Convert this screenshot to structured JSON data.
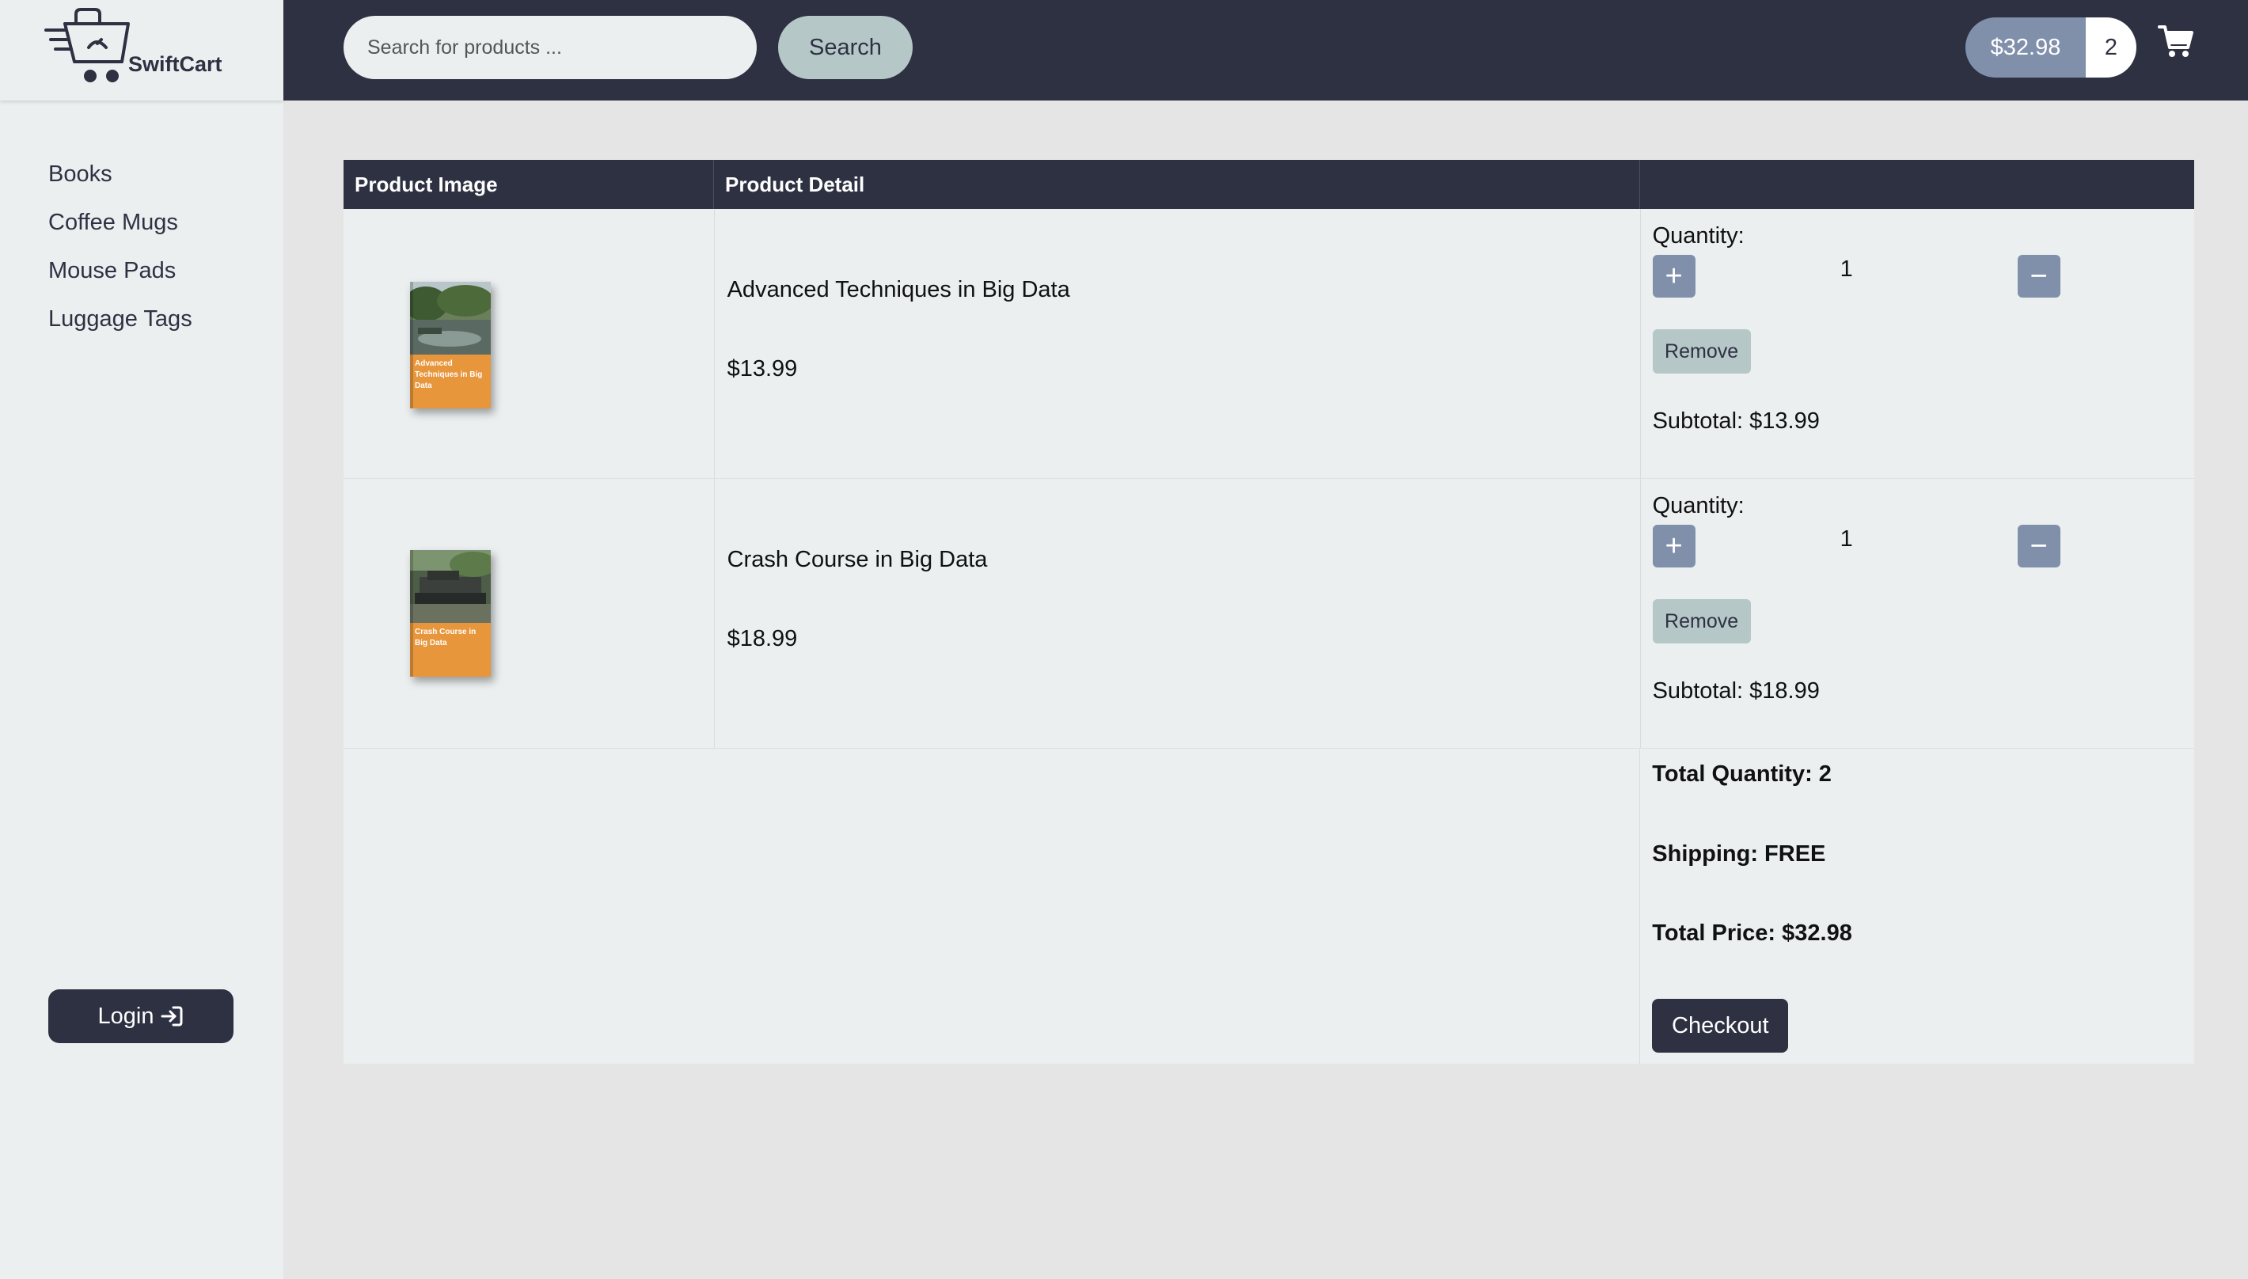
{
  "brand": {
    "name": "SwiftCart",
    "logo_icon": "shopping-cart-logo-icon"
  },
  "sidebar": {
    "items": [
      {
        "label": "Books"
      },
      {
        "label": "Coffee Mugs"
      },
      {
        "label": "Mouse Pads"
      },
      {
        "label": "Luggage Tags"
      }
    ],
    "login_label": "Login",
    "login_icon": "sign-in-icon"
  },
  "header": {
    "search_placeholder": "Search for products ...",
    "search_label": "Search",
    "cart_total": "$32.98",
    "cart_count": "2",
    "cart_icon": "shopping-cart-icon"
  },
  "table": {
    "headers": [
      "Product Image",
      "Product Detail",
      ""
    ],
    "rows": [
      {
        "name": "Advanced Techniques in Big Data",
        "price": "$13.99",
        "cover_text": "Advanced Techniques in Big Data",
        "quantity_label": "Quantity:",
        "quantity": "1",
        "remove_label": "Remove",
        "subtotal": "Subtotal: $13.99"
      },
      {
        "name": "Crash Course in Big Data",
        "price": "$18.99",
        "cover_text": "Crash Course in Big Data",
        "quantity_label": "Quantity:",
        "quantity": "1",
        "remove_label": "Remove",
        "subtotal": "Subtotal: $18.99"
      }
    ],
    "summary": {
      "total_quantity": "Total Quantity: 2",
      "shipping": "Shipping: FREE",
      "total_price": "Total Price: $32.98",
      "checkout_label": "Checkout"
    }
  },
  "colors": {
    "primary": "#2e3142",
    "accent": "#8090ab",
    "secondary": "#b6c7c8",
    "background": "#ebeff0",
    "book_cover": "#e7963c"
  }
}
